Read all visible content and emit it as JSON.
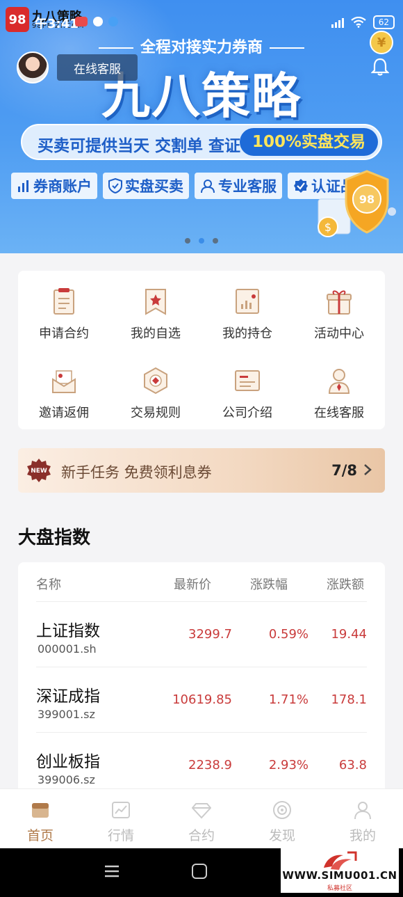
{
  "status_bar": {
    "time": "午3:41",
    "brand": "九八策略",
    "brand_url": "98PEIZI.COM",
    "logo_text": "98",
    "battery": "62"
  },
  "banner": {
    "subtitle": "全程对接实力券商",
    "title": "九八策略",
    "online_service": "在线客服",
    "slogan_left": "买卖可提供当天 交割单 查证",
    "slogan_right": "100%实盘交易",
    "features": [
      {
        "label": "券商账户",
        "icon": "bar-chart-icon"
      },
      {
        "label": "实盘买卖",
        "icon": "shield-icon"
      },
      {
        "label": "专业客服",
        "icon": "headset-icon"
      },
      {
        "label": "认证品牌",
        "icon": "verified-icon"
      }
    ],
    "coin_symbol": "¥",
    "page_count": 3,
    "active_page": 2
  },
  "menu": {
    "items": [
      {
        "label": "申请合约",
        "icon": "contract-icon"
      },
      {
        "label": "我的自选",
        "icon": "bookmark-star-icon"
      },
      {
        "label": "我的持仓",
        "icon": "holdings-chart-icon"
      },
      {
        "label": "活动中心",
        "icon": "gift-icon"
      },
      {
        "label": "邀请返佣",
        "icon": "envelope-icon"
      },
      {
        "label": "交易规则",
        "icon": "rules-hexagon-icon"
      },
      {
        "label": "公司介绍",
        "icon": "company-card-icon"
      },
      {
        "label": "在线客服",
        "icon": "support-person-icon"
      }
    ]
  },
  "newbie_task": {
    "badge": "NEW",
    "text": "新手任务 免费领利息券",
    "progress": "7/8"
  },
  "index_section": {
    "title": "大盘指数",
    "columns": [
      "名称",
      "最新价",
      "涨跌幅",
      "涨跌额"
    ],
    "rows": [
      {
        "name": "上证指数",
        "code": "000001.sh",
        "price": "3299.7",
        "pct": "0.59%",
        "chg": "19.44"
      },
      {
        "name": "深证成指",
        "code": "399001.sz",
        "price": "10619.85",
        "pct": "1.71%",
        "chg": "178.1"
      },
      {
        "name": "创业板指",
        "code": "399006.sz",
        "price": "2238.9",
        "pct": "2.93%",
        "chg": "63.8"
      }
    ],
    "up_color": "#c93b3b"
  },
  "tabbar": {
    "tabs": [
      {
        "label": "首页",
        "icon": "home-icon",
        "active": true
      },
      {
        "label": "行情",
        "icon": "market-chart-icon",
        "active": false
      },
      {
        "label": "合约",
        "icon": "diamond-icon",
        "active": false
      },
      {
        "label": "发现",
        "icon": "discover-icon",
        "active": false
      },
      {
        "label": "我的",
        "icon": "profile-icon",
        "active": false
      }
    ],
    "active_color": "#b07a4a"
  },
  "watermark": {
    "url": "WWW.SIMU001.CN",
    "sub": "私募社区"
  }
}
